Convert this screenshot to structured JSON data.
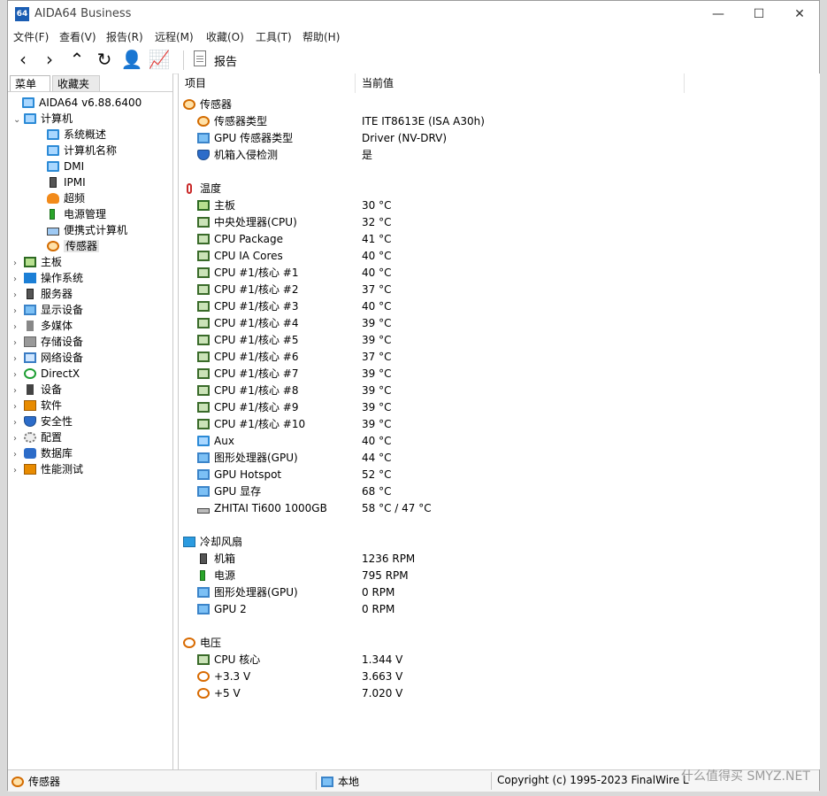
{
  "window": {
    "app_icon": "64",
    "title": "AIDA64 Business",
    "controls": {
      "minimize": "—",
      "maximize": "☐",
      "close": "✕"
    }
  },
  "menu": [
    "文件(F)",
    "查看(V)",
    "报告(R)",
    "远程(M)",
    "收藏(O)",
    "工具(T)",
    "帮助(H)"
  ],
  "toolbar": {
    "buttons": [
      "back-icon",
      "forward-icon",
      "up-icon",
      "refresh-icon",
      "user-icon",
      "chart-icon"
    ],
    "report_label": "报告"
  },
  "left_panel": {
    "tabs": [
      "菜单",
      "收藏夹"
    ],
    "root_label": "AIDA64 v6.88.6400",
    "computer_label": "计算机",
    "computer_children": [
      {
        "label": "系统概述",
        "icon": "computer"
      },
      {
        "label": "计算机名称",
        "icon": "computer"
      },
      {
        "label": "DMI",
        "icon": "computer"
      },
      {
        "label": "IPMI",
        "icon": "case"
      },
      {
        "label": "超频",
        "icon": "flame"
      },
      {
        "label": "电源管理",
        "icon": "psu"
      },
      {
        "label": "便携式计算机",
        "icon": "laptop"
      },
      {
        "label": "传感器",
        "icon": "gauge",
        "selected": true
      }
    ],
    "top_items": [
      {
        "label": "主板",
        "icon": "board"
      },
      {
        "label": "操作系统",
        "icon": "win"
      },
      {
        "label": "服务器",
        "icon": "case"
      },
      {
        "label": "显示设备",
        "icon": "mon"
      },
      {
        "label": "多媒体",
        "icon": "speaker"
      },
      {
        "label": "存储设备",
        "icon": "gray"
      },
      {
        "label": "网络设备",
        "icon": "net"
      },
      {
        "label": "DirectX",
        "icon": "xbox"
      },
      {
        "label": "设备",
        "icon": "dev"
      },
      {
        "label": "软件",
        "icon": "orange"
      },
      {
        "label": "安全性",
        "icon": "shield"
      },
      {
        "label": "配置",
        "icon": "gear"
      },
      {
        "label": "数据库",
        "icon": "db"
      },
      {
        "label": "性能测试",
        "icon": "orange"
      }
    ]
  },
  "right_panel": {
    "columns": [
      "项目",
      "当前值"
    ],
    "sections": [
      {
        "title": "传感器",
        "icon": "gauge",
        "rows": [
          {
            "name": "传感器类型",
            "value": "ITE IT8613E  (ISA A30h)",
            "icon": "gauge"
          },
          {
            "name": "GPU 传感器类型",
            "value": "Driver  (NV-DRV)",
            "icon": "mon"
          },
          {
            "name": "机箱入侵检测",
            "value": "是",
            "icon": "shield"
          }
        ]
      },
      {
        "title": "温度",
        "icon": "thermo",
        "rows": [
          {
            "name": "主板",
            "value": "30 °C",
            "icon": "board"
          },
          {
            "name": "中央处理器(CPU)",
            "value": "32 °C",
            "icon": "chip"
          },
          {
            "name": "CPU Package",
            "value": "41 °C",
            "icon": "chip"
          },
          {
            "name": "CPU IA Cores",
            "value": "40 °C",
            "icon": "chip"
          },
          {
            "name": "CPU #1/核心 #1",
            "value": "40 °C",
            "icon": "chip"
          },
          {
            "name": "CPU #1/核心 #2",
            "value": "37 °C",
            "icon": "chip"
          },
          {
            "name": "CPU #1/核心 #3",
            "value": "40 °C",
            "icon": "chip"
          },
          {
            "name": "CPU #1/核心 #4",
            "value": "39 °C",
            "icon": "chip"
          },
          {
            "name": "CPU #1/核心 #5",
            "value": "39 °C",
            "icon": "chip"
          },
          {
            "name": "CPU #1/核心 #6",
            "value": "37 °C",
            "icon": "chip"
          },
          {
            "name": "CPU #1/核心 #7",
            "value": "39 °C",
            "icon": "chip"
          },
          {
            "name": "CPU #1/核心 #8",
            "value": "39 °C",
            "icon": "chip"
          },
          {
            "name": "CPU #1/核心 #9",
            "value": "39 °C",
            "icon": "chip"
          },
          {
            "name": "CPU #1/核心 #10",
            "value": "39 °C",
            "icon": "chip"
          },
          {
            "name": "Aux",
            "value": "40 °C",
            "icon": "computer"
          },
          {
            "name": "图形处理器(GPU)",
            "value": "44 °C",
            "icon": "mon"
          },
          {
            "name": "GPU Hotspot",
            "value": "52 °C",
            "icon": "mon"
          },
          {
            "name": "GPU 显存",
            "value": "68 °C",
            "icon": "mon"
          },
          {
            "name": "ZHITAI Ti600 1000GB",
            "value": "58 °C / 47 °C",
            "icon": "drive"
          }
        ]
      },
      {
        "title": "冷却风扇",
        "icon": "fan",
        "rows": [
          {
            "name": "机箱",
            "value": "1236 RPM",
            "icon": "case"
          },
          {
            "name": "电源",
            "value": "795 RPM",
            "icon": "psu"
          },
          {
            "name": "图形处理器(GPU)",
            "value": "0 RPM",
            "icon": "mon"
          },
          {
            "name": "GPU 2",
            "value": "0 RPM",
            "icon": "mon"
          }
        ]
      },
      {
        "title": "电压",
        "icon": "volt",
        "rows": [
          {
            "name": "CPU 核心",
            "value": "1.344 V",
            "icon": "chip"
          },
          {
            "name": "+3.3 V",
            "value": "3.663 V",
            "icon": "volt"
          },
          {
            "name": "+5 V",
            "value": "7.020 V",
            "icon": "volt"
          }
        ]
      }
    ]
  },
  "statusbar": {
    "left": "传感器",
    "middle": "本地",
    "right": "Copyright (c) 1995-2023 FinalWire L"
  },
  "watermark": "什么值得买 SMYZ.NET"
}
